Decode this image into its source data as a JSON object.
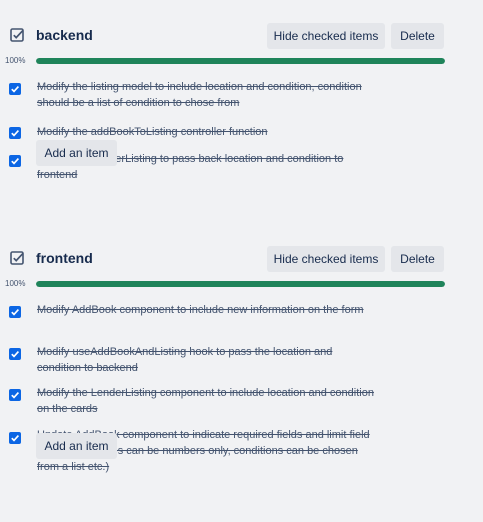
{
  "checklists": [
    {
      "title": "backend",
      "hide_label": "Hide checked items",
      "delete_label": "Delete",
      "progress_text": "100%",
      "progress": 1.0,
      "items": [
        {
          "text": "Modify the listing model to include location and condition, condition should be a list of condition to chose from",
          "checked": true
        },
        {
          "text": "Modify the addBookToListing controller function",
          "checked": true
        },
        {
          "text": "Update getLenderListing to pass back location and condition to frontend",
          "checked": true
        }
      ],
      "add_label": "Add an item"
    },
    {
      "title": "frontend",
      "hide_label": "Hide checked items",
      "delete_label": "Delete",
      "progress_text": "100%",
      "progress": 1.0,
      "items": [
        {
          "text": "Modify AddBook component to include new information on the form",
          "checked": true
        },
        {
          "text": "Modify useAddBookAndListing hook to pass the location and condition to backend",
          "checked": true
        },
        {
          "text": "Modify the LenderListing component to include location and condition on the cards",
          "checked": true
        },
        {
          "text": "Update AddBook component to indicate required fields and limit field values (i.e. pages can be numbers only, conditions can be chosen from a list etc.)",
          "checked": true
        }
      ],
      "add_label": "Add an item"
    }
  ],
  "colors": {
    "background": "#f1f2f4",
    "progress_fill": "#1f845a",
    "checkbox": "#0c66e4",
    "button": "#e4e6ea"
  },
  "icons": {
    "checklist": "checklist-icon",
    "checkbox": "check-icon"
  }
}
